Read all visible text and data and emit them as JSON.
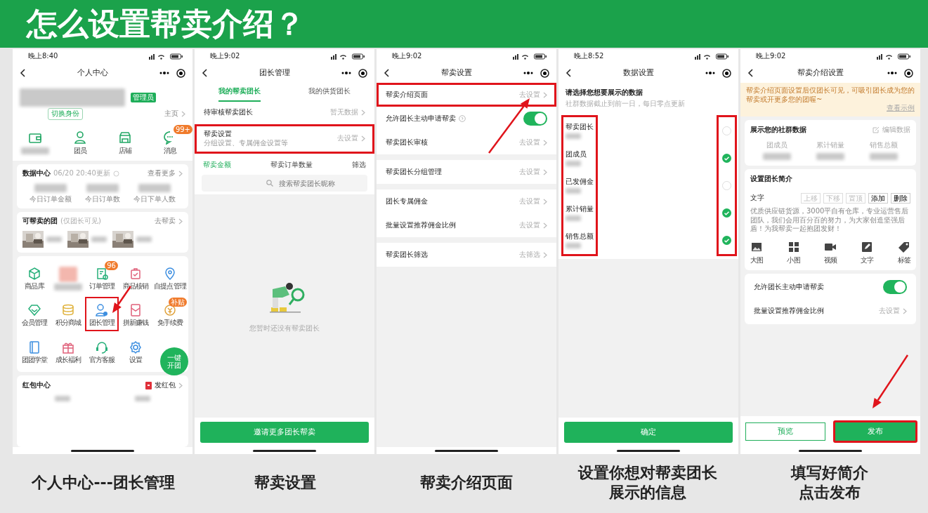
{
  "title": "怎么设置帮卖介绍？",
  "phones": [
    {
      "kind": "profile_center",
      "status_time": "晚上8:40",
      "page_title": "个人中心",
      "profile": {
        "role_tag": "管理员",
        "switch_label": "切换身份",
        "home_link": "主页"
      },
      "shortcuts": [
        {
          "kind": "blurred"
        },
        {
          "kind": "labelled",
          "label": "团员"
        },
        {
          "kind": "labelled",
          "label": "店铺"
        },
        {
          "kind": "labelled",
          "label": "消息",
          "badge": "99+"
        }
      ],
      "data_center": {
        "title": "数据中心",
        "updated": "06/20 20:40更新",
        "more": "查看更多",
        "stats": [
          "今日订单金额",
          "今日订单数",
          "今日下单人数"
        ]
      },
      "groups": {
        "title": "可帮卖的团",
        "note": "(仅团长可见)",
        "more": "去帮卖"
      },
      "tools": [
        {
          "label": "商品库",
          "highlighted": false
        },
        {
          "kind": "blurred",
          "highlighted": false
        },
        {
          "label": "订单管理",
          "badge": "96",
          "highlighted": false
        },
        {
          "label": "商品核销",
          "highlighted": false
        },
        {
          "label": "自提点管理",
          "highlighted": false
        },
        {
          "label": "会员管理",
          "highlighted": false
        },
        {
          "label": "积分商城",
          "highlighted": false
        },
        {
          "label": "团长管理",
          "highlighted": true
        },
        {
          "label": "拼新赚钱",
          "highlighted": false
        },
        {
          "label": "免手续费",
          "badge": "补贴",
          "highlighted": false
        },
        {
          "label": "团团学堂",
          "highlighted": false
        },
        {
          "label": "成长福利",
          "highlighted": false
        },
        {
          "label": "官方客服",
          "highlighted": false
        },
        {
          "label": "设置",
          "highlighted": false
        }
      ],
      "fab": "一键开团",
      "red_packet": {
        "title": "红包中心",
        "action": "发红包"
      }
    },
    {
      "kind": "leader_list",
      "status_time": "晚上9:02",
      "page_title": "团长管理",
      "tabs": [
        {
          "label": "我的帮卖团长",
          "selected": true
        },
        {
          "label": "我的供货团长",
          "selected": false
        }
      ],
      "rows": [
        {
          "label": "待审核帮卖团长",
          "value": "暂无数据",
          "highlighted": false
        },
        {
          "label": "帮卖设置",
          "sub": "分组设置、专属佣金设置等",
          "value": "去设置",
          "highlighted": true
        }
      ],
      "sorts": [
        {
          "label": "帮卖金额",
          "selected": true
        },
        {
          "label": "帮卖订单数量",
          "selected": false
        },
        {
          "label": "筛选",
          "selected": false
        }
      ],
      "search": {
        "placeholder": "搜索帮卖团长昵称"
      },
      "empty_text": "您暂时还没有帮卖团长",
      "button": "邀请更多团长帮卖"
    },
    {
      "kind": "settings",
      "status_time": "晚上9:02",
      "page_title": "帮卖设置",
      "groups": [
        [
          {
            "label": "帮卖介绍页面",
            "value": "去设置",
            "highlighted": true
          },
          {
            "kind": "toggle",
            "label": "允许团长主动申请帮卖",
            "help": true,
            "on": true
          },
          {
            "label": "帮卖团长审核",
            "value": "去设置",
            "highlighted": false
          }
        ],
        [
          {
            "label": "帮卖团长分组管理",
            "value": "去设置",
            "highlighted": false
          }
        ],
        [
          {
            "label": "团长专属佣金",
            "value": "去设置",
            "highlighted": false
          },
          {
            "label": "批量设置推荐佣金比例",
            "value": "去设置",
            "highlighted": false
          }
        ],
        [
          {
            "label": "帮卖团长筛选",
            "value": "去筛选",
            "highlighted": false
          }
        ]
      ]
    },
    {
      "kind": "data_select",
      "status_time": "晚上8:52",
      "page_title": "数据设置",
      "heading": "请选择您想要展示的数据",
      "note": "社群数据截止到前一日，每日零点更新",
      "highlighted": true,
      "options": [
        {
          "label": "帮卖团长",
          "checked": false
        },
        {
          "label": "团成员",
          "checked": true
        },
        {
          "label": "已发佣金",
          "checked": false
        },
        {
          "label": "累计销量",
          "checked": true
        },
        {
          "label": "销售总额",
          "checked": true
        }
      ],
      "button": "确定"
    },
    {
      "kind": "intro_editor",
      "status_time": "晚上9:02",
      "page_title": "帮卖介绍设置",
      "notice": "帮卖介绍页面设置后仅团长可见，可吸引团长成为您的帮卖或开更多您的团喔~",
      "notice_link": "查看示例",
      "stats_card": {
        "title": "展示您的社群数据",
        "action": "编辑数据",
        "stats": [
          "团成员",
          "累计销量",
          "销售总额"
        ]
      },
      "intro_card": {
        "title": "设置团长简介",
        "block_label": "文字",
        "actions": [
          {
            "label": "上移",
            "disabled": true
          },
          {
            "label": "下移",
            "disabled": true
          },
          {
            "label": "置顶",
            "disabled": true
          },
          {
            "label": "添加",
            "disabled": false
          },
          {
            "label": "删除",
            "disabled": false
          }
        ],
        "text": "优质供应链货源，3000平自有仓库，专业运营售后团队，我们会用百分百的努力，为大家创造坚强后盾！为我帮卖一起抱团发财！",
        "tools": [
          "大图",
          "小图",
          "视频",
          "文字",
          "标签"
        ]
      },
      "rows": [
        {
          "kind": "toggle",
          "label": "允许团长主动申请帮卖",
          "on": true
        },
        {
          "label": "批量设置推荐佣金比例",
          "value": "去设置",
          "highlighted": false
        }
      ],
      "buttons": [
        {
          "label": "预览",
          "kind": "outline",
          "highlighted": false
        },
        {
          "label": "发布",
          "kind": "primary",
          "highlighted": true
        }
      ]
    }
  ],
  "captions": [
    [
      "个人中心---团长管理"
    ],
    [
      "帮卖设置"
    ],
    [
      "帮卖介绍页面"
    ],
    [
      "设置你想对帮卖团长",
      "展示的信息"
    ],
    [
      "填写好简介",
      "点击发布"
    ]
  ]
}
